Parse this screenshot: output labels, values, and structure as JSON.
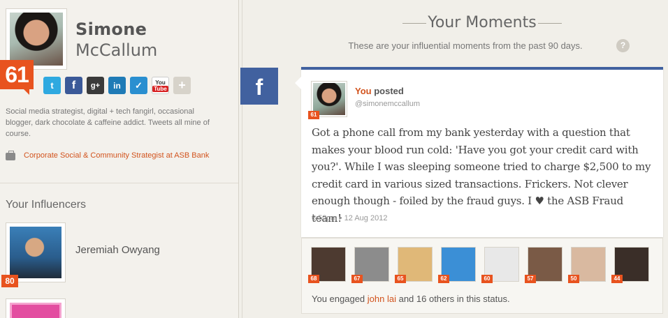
{
  "profile": {
    "first_name": "Simone",
    "last_name": "McCallum",
    "score": "61",
    "bio": "Social media strategist, digital + tech fangirl, occasional blogger, dark chocolate & caffeine addict. Tweets all mine of course.",
    "job": "Corporate Social & Community Strategist at ASB Bank",
    "social": [
      {
        "name": "twitter",
        "glyph": "t"
      },
      {
        "name": "facebook",
        "glyph": "f"
      },
      {
        "name": "google-plus",
        "glyph": "g+"
      },
      {
        "name": "linkedin",
        "glyph": "in"
      },
      {
        "name": "foursquare",
        "glyph": "✓"
      },
      {
        "name": "youtube",
        "glyph": "You"
      },
      {
        "name": "add",
        "glyph": "+"
      }
    ]
  },
  "influencers": {
    "title": "Your Influencers",
    "items": [
      {
        "name": "Jeremiah Owyang",
        "score": "80"
      }
    ]
  },
  "moments": {
    "title": "Your Moments",
    "subtitle": "These are your influential moments from the past 90 days.",
    "help": "?",
    "tab_icon": "f"
  },
  "post": {
    "author": "You",
    "action": " posted",
    "handle": "@simonemccallum",
    "score": "61",
    "text": "Got a phone call from my bank yesterday with a question that makes your blood run cold: 'Have you got your credit card with you?'. While I was sleeping someone tried to charge $2,500 to my credit card in various sized transactions. Frickers. Not clever enough though - foiled by the fraud guys. I ♥ the ASB Fraud team!",
    "time": "6:52pm • 12 Aug 2012"
  },
  "engagement": {
    "scores": [
      "68",
      "67",
      "65",
      "62",
      "60",
      "57",
      "50",
      "44"
    ],
    "colors": [
      "#4d3a30",
      "#8c8c8c",
      "#e0b878",
      "#3b8fd6",
      "#e8e8e8",
      "#7a5a46",
      "#d9b9a0",
      "#3a2e28"
    ],
    "prefix": "You engaged ",
    "who": "john lai",
    "suffix": " and 16 others in this status."
  }
}
